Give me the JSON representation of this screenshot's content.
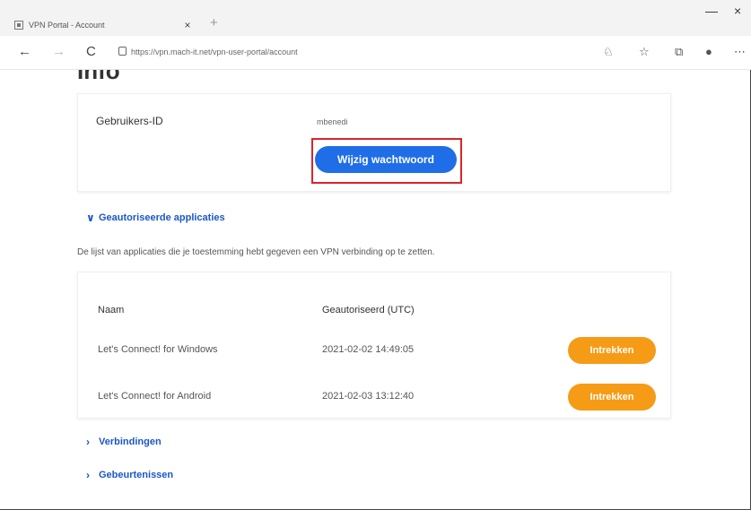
{
  "browser": {
    "tab_title": "VPN Portal - Account",
    "tab_close": "×",
    "new_tab": "+",
    "address": "https://vpn.mach-it.net/vpn-user-portal/account",
    "back": "←",
    "forward": "→",
    "reload": "C",
    "icons": [
      "read-aloud-icon",
      "favorites-icon",
      "collections-icon",
      "profile-icon",
      "more-icon"
    ],
    "win_minimize": "—",
    "win_maximize": "□",
    "win_close": "×"
  },
  "page": {
    "heading": "Info",
    "user": {
      "label": "Gebruikers-ID",
      "value": "mbenedi",
      "change_password": "Wijzig wachtwoord"
    },
    "apps": {
      "toggle_label": "Geautoriseerde applicaties",
      "description": "De lijst van applicaties die je toestemming hebt gegeven een VPN verbinding op te zetten.",
      "columns": [
        "Naam",
        "Geautoriseerd (UTC)"
      ],
      "rows": [
        {
          "name": "Let's Connect! for Windows",
          "date": "2021-02-02 14:49:05",
          "action": "Intrekken"
        },
        {
          "name": "Let's Connect! for Android",
          "date": "2021-02-03 13:12:40",
          "action": "Intrekken"
        }
      ]
    },
    "connections_label": "Verbindingen",
    "events_label": "Gebeurtenissen"
  },
  "colors": {
    "primary": "#1f6ee8",
    "revoke": "#f59b16",
    "highlight": "#d9252b",
    "link": "#1a57c8"
  }
}
